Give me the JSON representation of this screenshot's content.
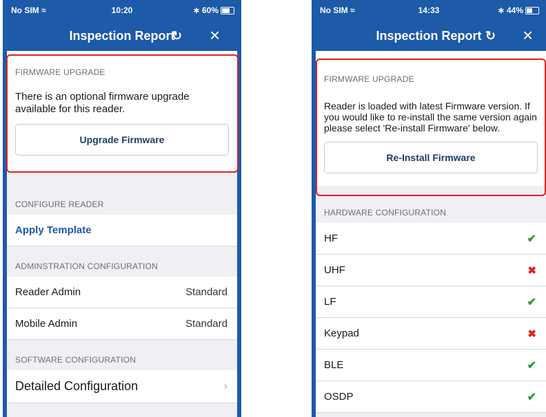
{
  "left": {
    "status": {
      "carrier": "No SIM",
      "time": "10:20",
      "battery": "60%",
      "battery_level": 0.6
    },
    "nav": {
      "title": "Inspection Report",
      "refresh_icon": "refresh-icon",
      "close_icon": "close-icon"
    },
    "firmware": {
      "header": "FIRMWARE UPGRADE",
      "description": "There is an optional firmware upgrade available for this reader.",
      "button": "Upgrade Firmware"
    },
    "configure": {
      "header": "CONFIGURE READER",
      "apply_template": "Apply Template"
    },
    "admin": {
      "header": "ADMINSTRATION CONFIGURATION",
      "rows": [
        {
          "label": "Reader Admin",
          "value": "Standard"
        },
        {
          "label": "Mobile Admin",
          "value": "Standard"
        }
      ]
    },
    "software": {
      "header": "SOFTWARE CONFIGURATION",
      "detailed": "Detailed Configuration"
    }
  },
  "right": {
    "status": {
      "carrier": "No SIM",
      "time": "14:33",
      "battery": "44%",
      "battery_level": 0.44
    },
    "nav": {
      "title": "Inspection Report"
    },
    "firmware": {
      "header": "FIRMWARE UPGRADE",
      "description": "Reader is loaded with latest Firmware version. If you would like to re-install the same version again please select 'Re-install Firmware' below.",
      "button": "Re-Install Firmware"
    },
    "hardware": {
      "header": "HARDWARE CONFIGURATION",
      "rows": [
        {
          "label": "HF",
          "enabled": true
        },
        {
          "label": "UHF",
          "enabled": false
        },
        {
          "label": "LF",
          "enabled": true
        },
        {
          "label": "Keypad",
          "enabled": false
        },
        {
          "label": "BLE",
          "enabled": true
        },
        {
          "label": "OSDP",
          "enabled": true
        }
      ]
    }
  },
  "colors": {
    "brand": "#1d5aa8",
    "highlight": "#e02020",
    "check": "#2e9a2e"
  }
}
